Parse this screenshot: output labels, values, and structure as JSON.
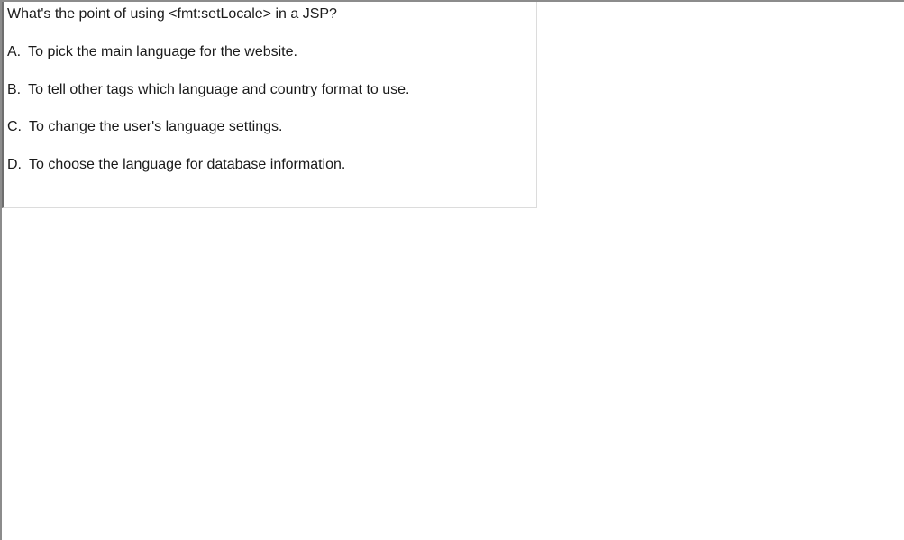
{
  "question": {
    "text": "What's the point of using <fmt:setLocale> in a JSP?"
  },
  "options": [
    {
      "letter": "A.",
      "text": "To pick the main language for the website."
    },
    {
      "letter": "B.",
      "text": "To tell other tags which language and country format to use."
    },
    {
      "letter": "C.",
      "text": "To change the user's language settings."
    },
    {
      "letter": "D.",
      "text": "To choose the language for database information."
    }
  ]
}
